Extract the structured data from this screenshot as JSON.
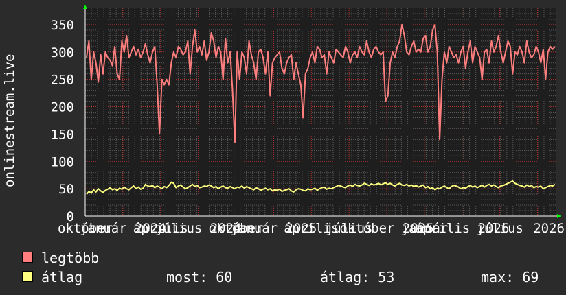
{
  "chart_data": {
    "type": "line",
    "ylabel": "onlinestream.live",
    "ylim": [
      0,
      380
    ],
    "yticks": [
      0,
      50,
      100,
      150,
      200,
      250,
      300,
      350
    ],
    "x_tick_labels": [
      "október",
      "január 2024",
      "április",
      "július 2024",
      "október",
      "január 2025",
      "április",
      "július",
      "október 2025",
      "január",
      "április 2026",
      "július",
      "2026"
    ],
    "colors": {
      "max": "#ff7f7f",
      "avg": "#ffff7f",
      "grid_major": "#b03030",
      "grid_minor": "#5a5a5a",
      "plot_bg": "#1e1e1e"
    },
    "series": [
      {
        "name": "legtöbb",
        "color": "#ff7f7f",
        "values": [
          290,
          320,
          250,
          300,
          280,
          245,
          295,
          260,
          300,
          290,
          285,
          275,
          310,
          260,
          250,
          320,
          300,
          330,
          290,
          300,
          310,
          295,
          305,
          290,
          300,
          315,
          295,
          280,
          300,
          310,
          240,
          150,
          250,
          240,
          250,
          240,
          280,
          300,
          290,
          310,
          305,
          295,
          300,
          320,
          260,
          310,
          340,
          300,
          310,
          295,
          320,
          285,
          300,
          335,
          320,
          290,
          310,
          300,
          250,
          325,
          280,
          300,
          230,
          135,
          300,
          250,
          300,
          290,
          260,
          320,
          295,
          280,
          250,
          300,
          305,
          290,
          260,
          300,
          220,
          280,
          290,
          295,
          300,
          270,
          260,
          280,
          290,
          295,
          250,
          280,
          260,
          240,
          180,
          260,
          270,
          290,
          300,
          280,
          310,
          305,
          290,
          295,
          260,
          300,
          290,
          280,
          305,
          300,
          295,
          290,
          310,
          300,
          280,
          295,
          300,
          290,
          310,
          300,
          295,
          320,
          300,
          290,
          305,
          310,
          300,
          295,
          300,
          210,
          220,
          280,
          300,
          290,
          310,
          320,
          350,
          330,
          300,
          295,
          310,
          320,
          300,
          305,
          300,
          325,
          330,
          300,
          310,
          340,
          350,
          300,
          140,
          250,
          300,
          280,
          310,
          300,
          290,
          295,
          280,
          300,
          310,
          270,
          300,
          320,
          280,
          310,
          300,
          290,
          250,
          300,
          305,
          280,
          320,
          300,
          310,
          330,
          300,
          280,
          300,
          320,
          310,
          260,
          300,
          295,
          310,
          300,
          280,
          320,
          300,
          290,
          295,
          310,
          300,
          280,
          305,
          250,
          300,
          310,
          305,
          310
        ]
      },
      {
        "name": "átlag",
        "color": "#ffff7f",
        "values": [
          40,
          45,
          42,
          48,
          44,
          50,
          46,
          43,
          47,
          49,
          52,
          48,
          50,
          47,
          51,
          49,
          53,
          50,
          48,
          52,
          55,
          50,
          53,
          49,
          51,
          58,
          55,
          54,
          56,
          52,
          55,
          53,
          50,
          54,
          52,
          56,
          62,
          60,
          52,
          55,
          57,
          53,
          50,
          52,
          55,
          58,
          54,
          56,
          52,
          53,
          55,
          54,
          57,
          55,
          52,
          54,
          50,
          53,
          55,
          52,
          51,
          54,
          52,
          50,
          53,
          52,
          55,
          51,
          54,
          52,
          50,
          48,
          52,
          50,
          47,
          49,
          51,
          48,
          50,
          46,
          48,
          47,
          49,
          45,
          47,
          48,
          50,
          46,
          44,
          48,
          50,
          49,
          47,
          46,
          50,
          48,
          49,
          51,
          47,
          50,
          52,
          53,
          49,
          51,
          50,
          52,
          54,
          56,
          55,
          53,
          52,
          55,
          57,
          54,
          58,
          56,
          55,
          57,
          60,
          58,
          56,
          59,
          57,
          58,
          60,
          57,
          59,
          61,
          58,
          60,
          57,
          55,
          58,
          60,
          57,
          56,
          58,
          55,
          57,
          54,
          56,
          53,
          55,
          57,
          52,
          54,
          50,
          52,
          48,
          51,
          50,
          53,
          55,
          52,
          50,
          54,
          56,
          55,
          53,
          50,
          52,
          51,
          54,
          56,
          53,
          55,
          52,
          54,
          57,
          53,
          56,
          58,
          55,
          57,
          54,
          52,
          55,
          56,
          58,
          60,
          62,
          64,
          60,
          58,
          56,
          55,
          53,
          57,
          54,
          56,
          52,
          54,
          53,
          55,
          50,
          52,
          54,
          56,
          55,
          58
        ]
      }
    ]
  },
  "legend": {
    "items": [
      {
        "label": "legtöbb",
        "color": "#ff7f7f"
      },
      {
        "label": "átlag",
        "color": "#ffff7f"
      }
    ],
    "stats": {
      "now_label": "most:",
      "now_value": "60",
      "avg_label": "átlag:",
      "avg_value": "53",
      "max_label": "max:",
      "max_value": "69"
    }
  }
}
